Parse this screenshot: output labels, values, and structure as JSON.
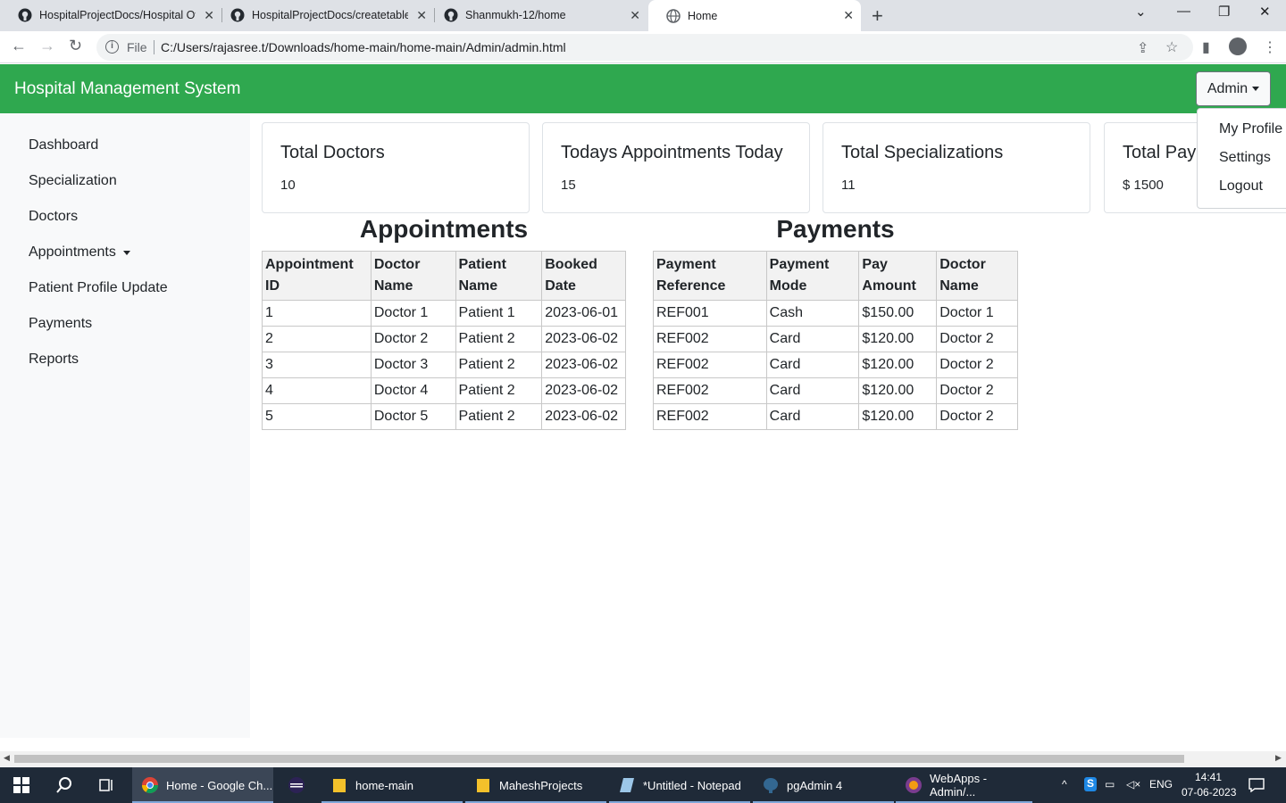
{
  "browser": {
    "tabs": [
      {
        "label": "HospitalProjectDocs/Hospital Ov",
        "icon": "github-icon"
      },
      {
        "label": "HospitalProjectDocs/createtables",
        "icon": "github-icon"
      },
      {
        "label": "Shanmukh-12/home",
        "icon": "github-icon"
      },
      {
        "label": "Home",
        "icon": "globe-icon"
      }
    ],
    "omnibox": {
      "scheme_label": "File",
      "url": "C:/Users/rajasree.t/Downloads/home-main/home-main/Admin/admin.html"
    }
  },
  "app": {
    "title": "Hospital Management System",
    "admin_button": "Admin",
    "accent": "#2fa84f"
  },
  "dropdown": {
    "items": [
      "My Profile",
      "Settings",
      "Logout"
    ]
  },
  "sidebar": {
    "items": [
      {
        "label": "Dashboard"
      },
      {
        "label": "Specialization"
      },
      {
        "label": "Doctors"
      },
      {
        "label": "Appointments"
      },
      {
        "label": "Patient Profile Update"
      },
      {
        "label": "Payments"
      },
      {
        "label": "Reports"
      }
    ]
  },
  "cards": [
    {
      "title": "Total Doctors",
      "value": "10"
    },
    {
      "title": "Todays Appointments Today",
      "value": "15"
    },
    {
      "title": "Total Specializations",
      "value": "11"
    },
    {
      "title": "Total Payments",
      "value": "$ 1500"
    }
  ],
  "appointments": {
    "heading": "Appointments",
    "columns": [
      "Appointment ID",
      "Doctor Name",
      "Patient Name",
      "Booked Date"
    ],
    "rows": [
      [
        "1",
        "Doctor 1",
        "Patient 1",
        "2023-06-01"
      ],
      [
        "2",
        "Doctor 2",
        "Patient 2",
        "2023-06-02"
      ],
      [
        "3",
        "Doctor 3",
        "Patient 2",
        "2023-06-02"
      ],
      [
        "4",
        "Doctor 4",
        "Patient 2",
        "2023-06-02"
      ],
      [
        "5",
        "Doctor 5",
        "Patient 2",
        "2023-06-02"
      ]
    ]
  },
  "payments": {
    "heading": "Payments",
    "columns": [
      "Payment Reference",
      "Payment Mode",
      "Pay Amount",
      "Doctor Name"
    ],
    "rows": [
      [
        "REF001",
        "Cash",
        "$150.00",
        "Doctor 1"
      ],
      [
        "REF002",
        "Card",
        "$120.00",
        "Doctor 2"
      ],
      [
        "REF002",
        "Card",
        "$120.00",
        "Doctor 2"
      ],
      [
        "REF002",
        "Card",
        "$120.00",
        "Doctor 2"
      ],
      [
        "REF002",
        "Card",
        "$120.00",
        "Doctor 2"
      ]
    ]
  },
  "taskbar": {
    "items": [
      {
        "label": "Home - Google Ch...",
        "icon": "chrome-icon"
      },
      {
        "label": "",
        "icon": "eclipse-icon"
      },
      {
        "label": "home-main",
        "icon": "folder-icon"
      },
      {
        "label": "MaheshProjects",
        "icon": "folder-icon"
      },
      {
        "label": "*Untitled - Notepad",
        "icon": "notepad-icon"
      },
      {
        "label": "pgAdmin 4",
        "icon": "pgadmin-icon"
      },
      {
        "label": "WebApps - Admin/...",
        "icon": "webapps-icon"
      }
    ],
    "lang": "ENG",
    "time": "14:41",
    "date": "07-06-2023"
  }
}
